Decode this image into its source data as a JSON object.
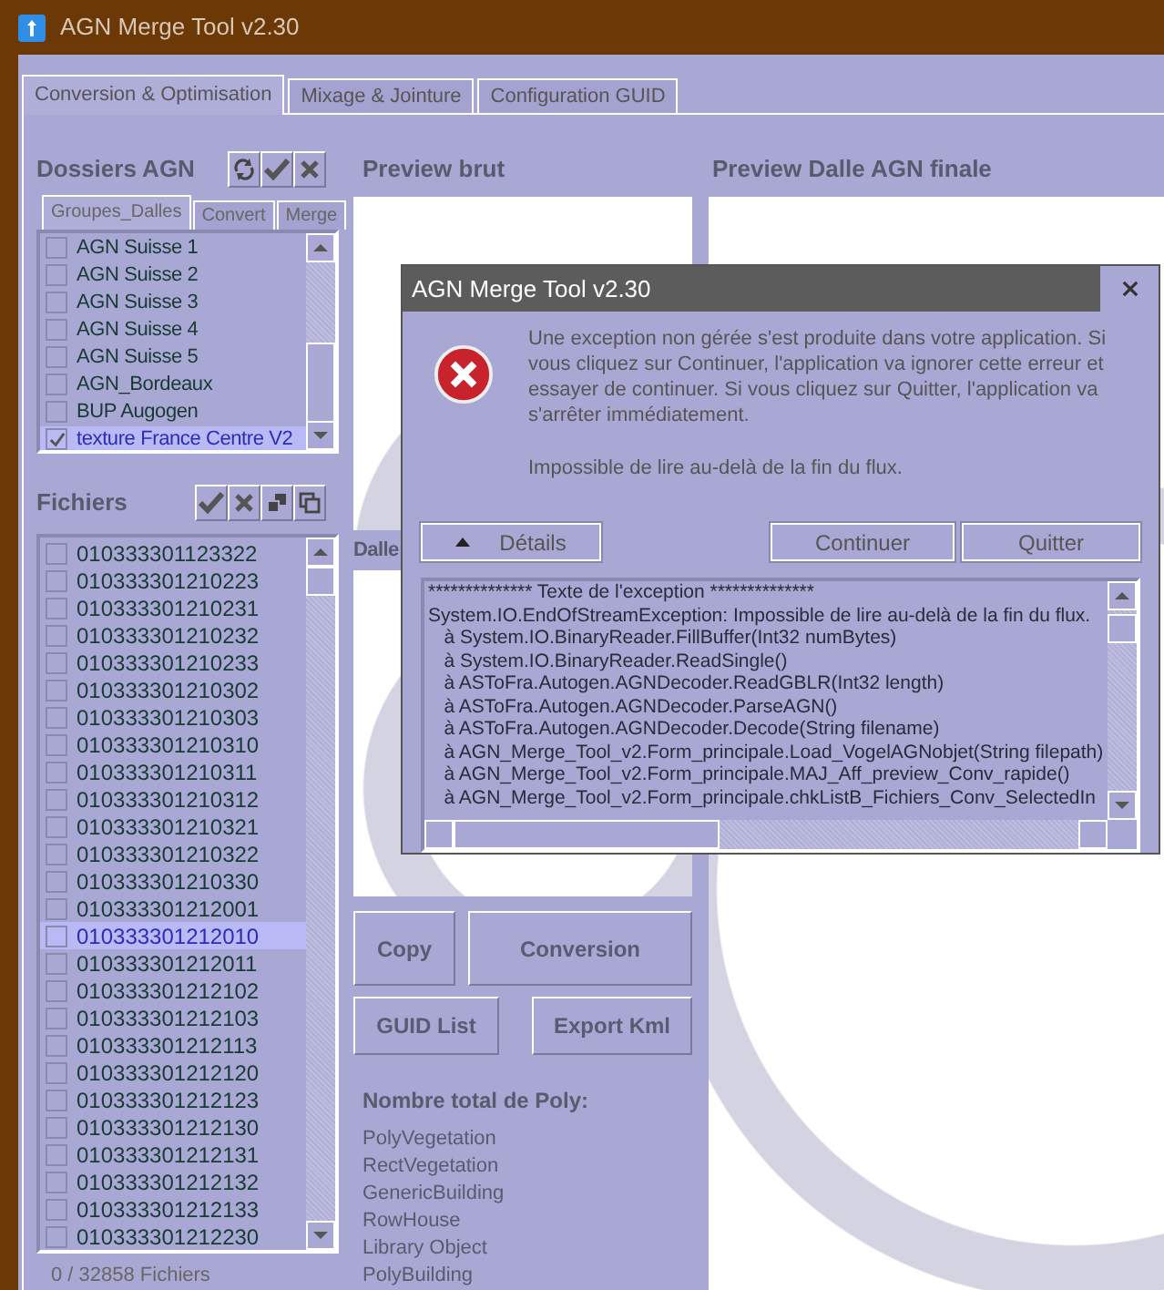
{
  "window": {
    "title": "AGN Merge Tool v2.30"
  },
  "tabs": [
    {
      "label": "Conversion & Optimisation",
      "selected": true
    },
    {
      "label": "Mixage & Jointure",
      "selected": false
    },
    {
      "label": "Configuration GUID",
      "selected": false
    }
  ],
  "folders": {
    "title": "Dossiers AGN",
    "subtabs": [
      {
        "label": "Groupes_Dalles",
        "selected": true
      },
      {
        "label": "Convert",
        "selected": false
      },
      {
        "label": "Merge",
        "selected": false
      }
    ],
    "items": [
      {
        "label": "AGN Suisse 1",
        "checked": false,
        "selected": false
      },
      {
        "label": "AGN Suisse 2",
        "checked": false,
        "selected": false
      },
      {
        "label": "AGN Suisse 3",
        "checked": false,
        "selected": false
      },
      {
        "label": "AGN Suisse 4",
        "checked": false,
        "selected": false
      },
      {
        "label": "AGN Suisse 5",
        "checked": false,
        "selected": false
      },
      {
        "label": "AGN_Bordeaux",
        "checked": false,
        "selected": false
      },
      {
        "label": "BUP Augogen",
        "checked": false,
        "selected": false
      },
      {
        "label": "texture France Centre V2",
        "checked": true,
        "selected": true
      }
    ]
  },
  "files": {
    "title": "Fichiers",
    "items": [
      {
        "label": "010333301123322",
        "checked": false,
        "selected": false
      },
      {
        "label": "010333301210223",
        "checked": false,
        "selected": false
      },
      {
        "label": "010333301210231",
        "checked": false,
        "selected": false
      },
      {
        "label": "010333301210232",
        "checked": false,
        "selected": false
      },
      {
        "label": "010333301210233",
        "checked": false,
        "selected": false
      },
      {
        "label": "010333301210302",
        "checked": false,
        "selected": false
      },
      {
        "label": "010333301210303",
        "checked": false,
        "selected": false
      },
      {
        "label": "010333301210310",
        "checked": false,
        "selected": false
      },
      {
        "label": "010333301210311",
        "checked": false,
        "selected": false
      },
      {
        "label": "010333301210312",
        "checked": false,
        "selected": false
      },
      {
        "label": "010333301210321",
        "checked": false,
        "selected": false
      },
      {
        "label": "010333301210322",
        "checked": false,
        "selected": false
      },
      {
        "label": "010333301210330",
        "checked": false,
        "selected": false
      },
      {
        "label": "010333301212001",
        "checked": false,
        "selected": false
      },
      {
        "label": "010333301212010",
        "checked": false,
        "selected": true
      },
      {
        "label": "010333301212011",
        "checked": false,
        "selected": false
      },
      {
        "label": "010333301212102",
        "checked": false,
        "selected": false
      },
      {
        "label": "010333301212103",
        "checked": false,
        "selected": false
      },
      {
        "label": "010333301212113",
        "checked": false,
        "selected": false
      },
      {
        "label": "010333301212120",
        "checked": false,
        "selected": false
      },
      {
        "label": "010333301212123",
        "checked": false,
        "selected": false
      },
      {
        "label": "010333301212130",
        "checked": false,
        "selected": false
      },
      {
        "label": "010333301212131",
        "checked": false,
        "selected": false
      },
      {
        "label": "010333301212132",
        "checked": false,
        "selected": false
      },
      {
        "label": "010333301212133",
        "checked": false,
        "selected": false
      },
      {
        "label": "010333301212230",
        "checked": false,
        "selected": false
      }
    ],
    "count": "0 / 32858 Fichiers"
  },
  "previews": {
    "raw_title": "Preview brut",
    "tile_title": "Dalle",
    "final_title": "Preview Dalle AGN finale"
  },
  "actions": [
    "Copy",
    "Conversion",
    "GUID List",
    "Export Kml"
  ],
  "poly": {
    "title": "Nombre total de Poly:",
    "items": [
      "PolyVegetation",
      "RectVegetation",
      "GenericBuilding",
      "RowHouse",
      "Library Object",
      "PolyBuilding"
    ]
  },
  "dialog": {
    "title": "AGN Merge Tool v2.30",
    "message": "Une exception non gérée s'est produite dans votre application. Si vous cliquez sur Continuer, l'application va ignorer cette erreur et essayer de continuer. Si vous cliquez sur Quitter, l'application va s'arrêter immédiatement.",
    "detail": "Impossible de lire au-delà de la fin du flux.",
    "details_button": "Détails",
    "continue_button": "Continuer",
    "quit_button": "Quitter",
    "exception_lines": [
      "************** Texte de l'exception **************",
      "System.IO.EndOfStreamException: Impossible de lire au-delà de la fin du flux.",
      "   à System.IO.BinaryReader.FillBuffer(Int32 numBytes)",
      "   à System.IO.BinaryReader.ReadSingle()",
      "   à ASToFra.Autogen.AGNDecoder.ReadGBLR(Int32 length)",
      "   à ASToFra.Autogen.AGNDecoder.ParseAGN()",
      "   à ASToFra.Autogen.AGNDecoder.Decode(String filename)",
      "   à AGN_Merge_Tool_v2.Form_principale.Load_VogelAGNobjet(String filepath)",
      "   à AGN_Merge_Tool_v2.Form_principale.MAJ_Aff_preview_Conv_rapide()",
      "   à AGN_Merge_Tool_v2.Form_principale.chkListB_Fichiers_Conv_SelectedIn"
    ]
  }
}
